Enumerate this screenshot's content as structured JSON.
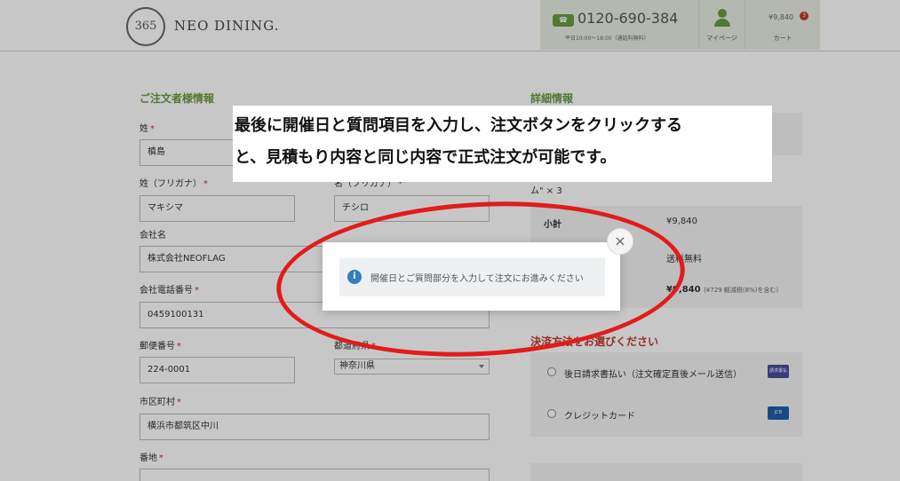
{
  "header": {
    "logo_number": "365",
    "logo_text": "NEO DINING.",
    "phone_icon": "phone-icon",
    "phone": "0120-690-384",
    "phone_hours": "平日10:00～18:00（通話料無料）",
    "mypage_label": "マイページ",
    "cart_price": "¥9,840",
    "cart_count": "3",
    "cart_label": "カート"
  },
  "form": {
    "section_title": "ご注文者様情報",
    "required_mark": "*",
    "last_name_label": "姓",
    "last_name_value": "槙島",
    "last_kana_label": "姓（フリガナ）",
    "last_kana_value": "マキシマ",
    "first_kana_label": "名（フリガナ）",
    "first_kana_value": "チシロ",
    "company_label": "会社名",
    "company_value": "株式会社NEOFLAG",
    "company_phone_label": "会社電話番号",
    "company_phone_value": "0459100131",
    "zip_label": "郵便番号",
    "zip_value": "224-0001",
    "pref_label": "都道府県",
    "pref_value": "神奈川県",
    "city_label": "市区町村",
    "city_value": "横浜市都筑区中川",
    "street_label": "番地"
  },
  "details": {
    "section_title": "詳細情報",
    "item_text": "ム\" × 3",
    "subtotal_label": "小計",
    "subtotal_value": "¥9,840",
    "shipping_value": "送料無料",
    "total_value": "¥9,840",
    "total_tax": "(¥729 軽減税(8%)を含む)"
  },
  "payment": {
    "section_title": "決済方法をお選びください",
    "option1": "後日請求書払い（注文確定直後メール送信）",
    "option1_icon": "invoice-card-icon",
    "option2": "クレジットカード",
    "option2_icon": "jcb-card-icon"
  },
  "modal": {
    "icon": "info-icon",
    "info_symbol": "i",
    "message": "開催日とご質問部分を入力して注文にお進みください",
    "close_symbol": "×"
  },
  "callout": {
    "line1": "最後に開催日と質問項目を入力し、注文ボタンをクリックする",
    "line2": "と、見積もり内容と同じ内容で正式注文が可能です。"
  },
  "colors": {
    "accent_green": "#6a9b42",
    "red": "#e21b1b",
    "info_blue": "#2f7fc1"
  }
}
